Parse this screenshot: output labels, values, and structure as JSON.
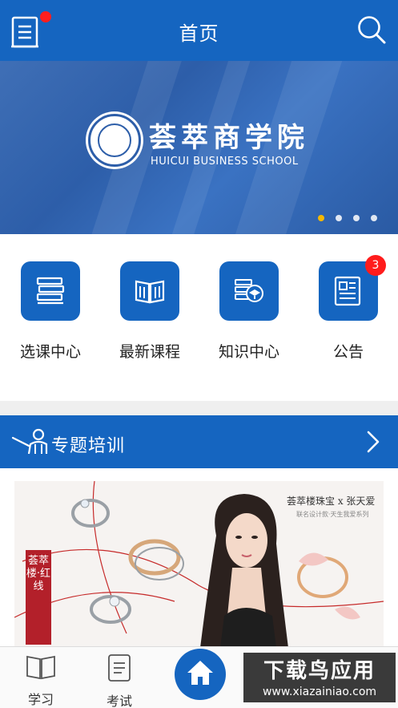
{
  "header": {
    "title": "首页",
    "menu_icon": "notebook-menu-icon",
    "search_icon": "search-icon",
    "accent": "#1565c0",
    "notification_color": "#ff1e1e"
  },
  "banner": {
    "school_name_cn": "荟萃商学院",
    "school_name_en": "HUICUI BUSINESS SCHOOL",
    "slide_count": 4,
    "active_slide": 1,
    "active_dot_color": "#f6b800"
  },
  "quick_menu": [
    {
      "label": "选课中心",
      "icon": "books-stack-icon"
    },
    {
      "label": "最新课程",
      "icon": "open-book-icon"
    },
    {
      "label": "知识中心",
      "icon": "graduation-knowledge-icon"
    },
    {
      "label": "公告",
      "icon": "notice-document-icon",
      "badge": "3"
    }
  ],
  "section": {
    "title": "专题培训",
    "icon": "teacher-presentation-icon",
    "more_icon": "chevron-right-icon"
  },
  "promo": {
    "brand_line": "荟萃楼珠宝 x 张天爱",
    "brand_sub": "联名设计款·天生我爱系列",
    "tag_text": "荟萃楼·红线"
  },
  "tabbar": {
    "tabs": [
      {
        "label": "学习",
        "icon": "book-icon"
      },
      {
        "label": "考试",
        "icon": "exam-paper-icon"
      }
    ],
    "home_icon": "home-icon",
    "watermark_line1": "下载鸟应用",
    "watermark_line2": "www.xiazainiao.com"
  }
}
